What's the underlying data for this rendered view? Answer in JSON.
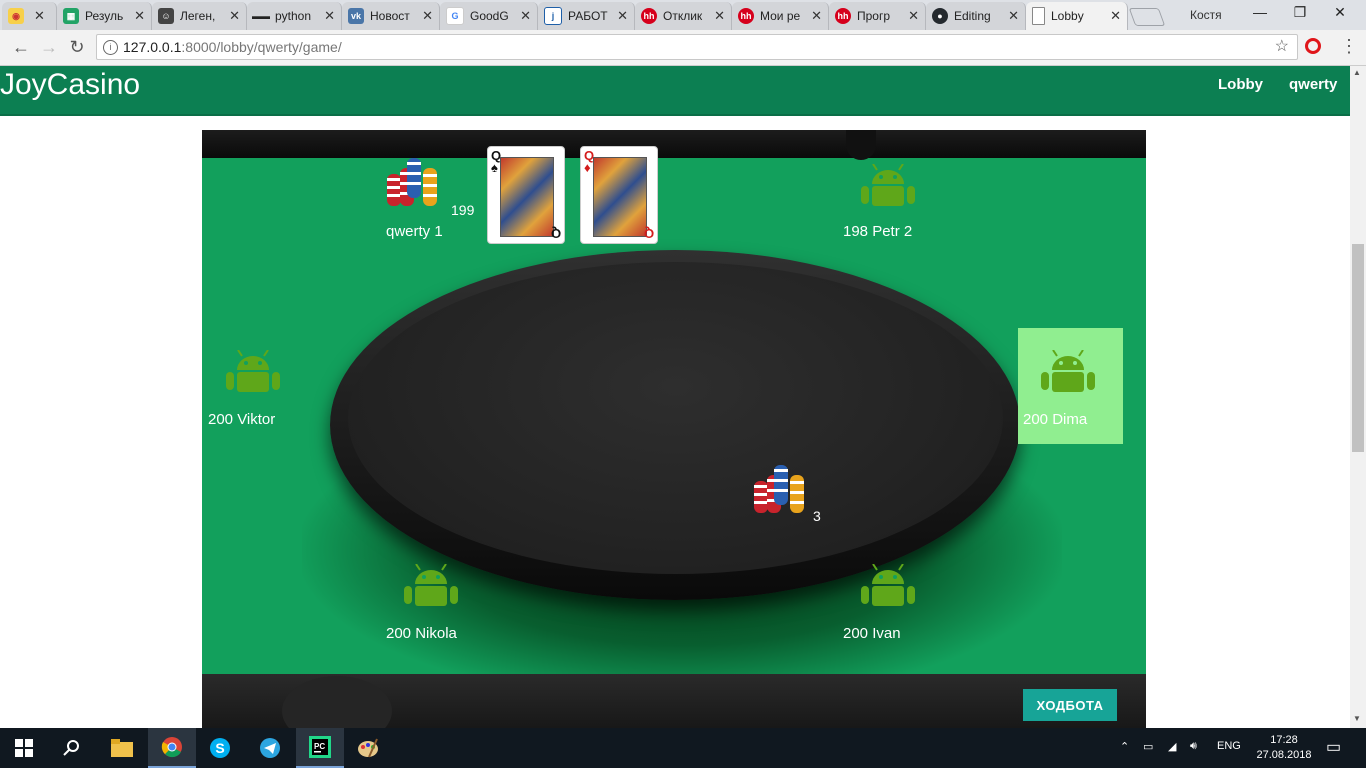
{
  "browser": {
    "tabs": [
      {
        "title": "",
        "favicon": "chrome-eye-icon",
        "color": "#ffcc33"
      },
      {
        "title": "Резуль",
        "favicon": "sheets-icon",
        "color": "#21a366"
      },
      {
        "title": "Леген,",
        "favicon": "avatar-icon",
        "color": "#444444"
      },
      {
        "title": "python",
        "favicon": "sunglasses-icon",
        "color": "#222222"
      },
      {
        "title": "Новост",
        "favicon": "vk-icon",
        "color": "#4a76a8"
      },
      {
        "title": "GoodG",
        "favicon": "google-icon",
        "color": "#4285f4"
      },
      {
        "title": "РАБОТ",
        "favicon": "j-icon",
        "color": "#1e5fa8"
      },
      {
        "title": "Отклик",
        "favicon": "hh-icon",
        "color": "#d6001c"
      },
      {
        "title": "Мои ре",
        "favicon": "hh-icon",
        "color": "#d6001c"
      },
      {
        "title": "Прогр",
        "favicon": "hh-icon",
        "color": "#d6001c"
      },
      {
        "title": "Editing",
        "favicon": "github-icon",
        "color": "#24292e"
      },
      {
        "title": "Lobby",
        "favicon": "page-icon",
        "color": "#888888",
        "active": true
      }
    ],
    "profile": "Костя",
    "url_host": "127.0.0.1",
    "url_rest": ":8000/lobby/qwerty/game/"
  },
  "app": {
    "brand": "JoyCasino",
    "nav": {
      "lobby": "Lobby",
      "user": "qwerty"
    },
    "accent": "#0c7f52",
    "felt": "#12a05c",
    "highlight": "#90ee90",
    "action_button": "ХОДБОТА"
  },
  "seats": {
    "qwerty": {
      "label": "qwerty 1",
      "chips": "199"
    },
    "petr": {
      "label": "198 Petr 2"
    },
    "viktor": {
      "label": "200 Viktor"
    },
    "dima": {
      "label": "200 Dima"
    },
    "nikola": {
      "label": "200 Nikola"
    },
    "ivan": {
      "label": "200 Ivan"
    }
  },
  "pot": "3",
  "cards": [
    {
      "rank": "Q",
      "suit": "♠",
      "color": "#111111"
    },
    {
      "rank": "Q",
      "suit": "♦",
      "color": "#d41c1c"
    }
  ],
  "taskbar": {
    "lang": "ENG",
    "time": "17:28",
    "date": "27.08.2018"
  }
}
